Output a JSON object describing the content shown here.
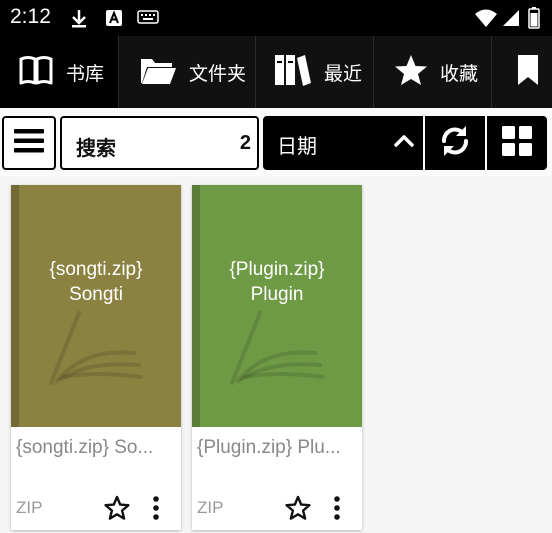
{
  "status_bar": {
    "time": "2:12",
    "icons": [
      "download-icon",
      "a-box-icon",
      "keyboard-icon",
      "wifi-icon",
      "signal-icon",
      "battery-icon"
    ]
  },
  "tabs": [
    {
      "label": "书库",
      "icon": "book-open-icon",
      "selected": true
    },
    {
      "label": "文件夹",
      "icon": "folder-icon",
      "selected": false
    },
    {
      "label": "最近",
      "icon": "books-icon",
      "selected": false
    },
    {
      "label": "收藏",
      "icon": "star-icon",
      "selected": false
    },
    {
      "label": "",
      "icon": "bookmark-icon",
      "selected": false
    }
  ],
  "toolbar": {
    "search_placeholder": "搜索",
    "result_count": "2",
    "sort_label": "日期"
  },
  "books": [
    {
      "cover_text_1": "{songti.zip}",
      "cover_text_2": "Songti",
      "title": "{songti.zip} So...",
      "format": "ZIP",
      "cover_color": "#8b8140"
    },
    {
      "cover_text_1": "{Plugin.zip}",
      "cover_text_2": "Plugin",
      "title": "{Plugin.zip} Plu...",
      "format": "ZIP",
      "cover_color": "#6e9a46"
    }
  ],
  "colors": {
    "bar_bg": "#000000",
    "page_bg": "#f5f5f5"
  }
}
